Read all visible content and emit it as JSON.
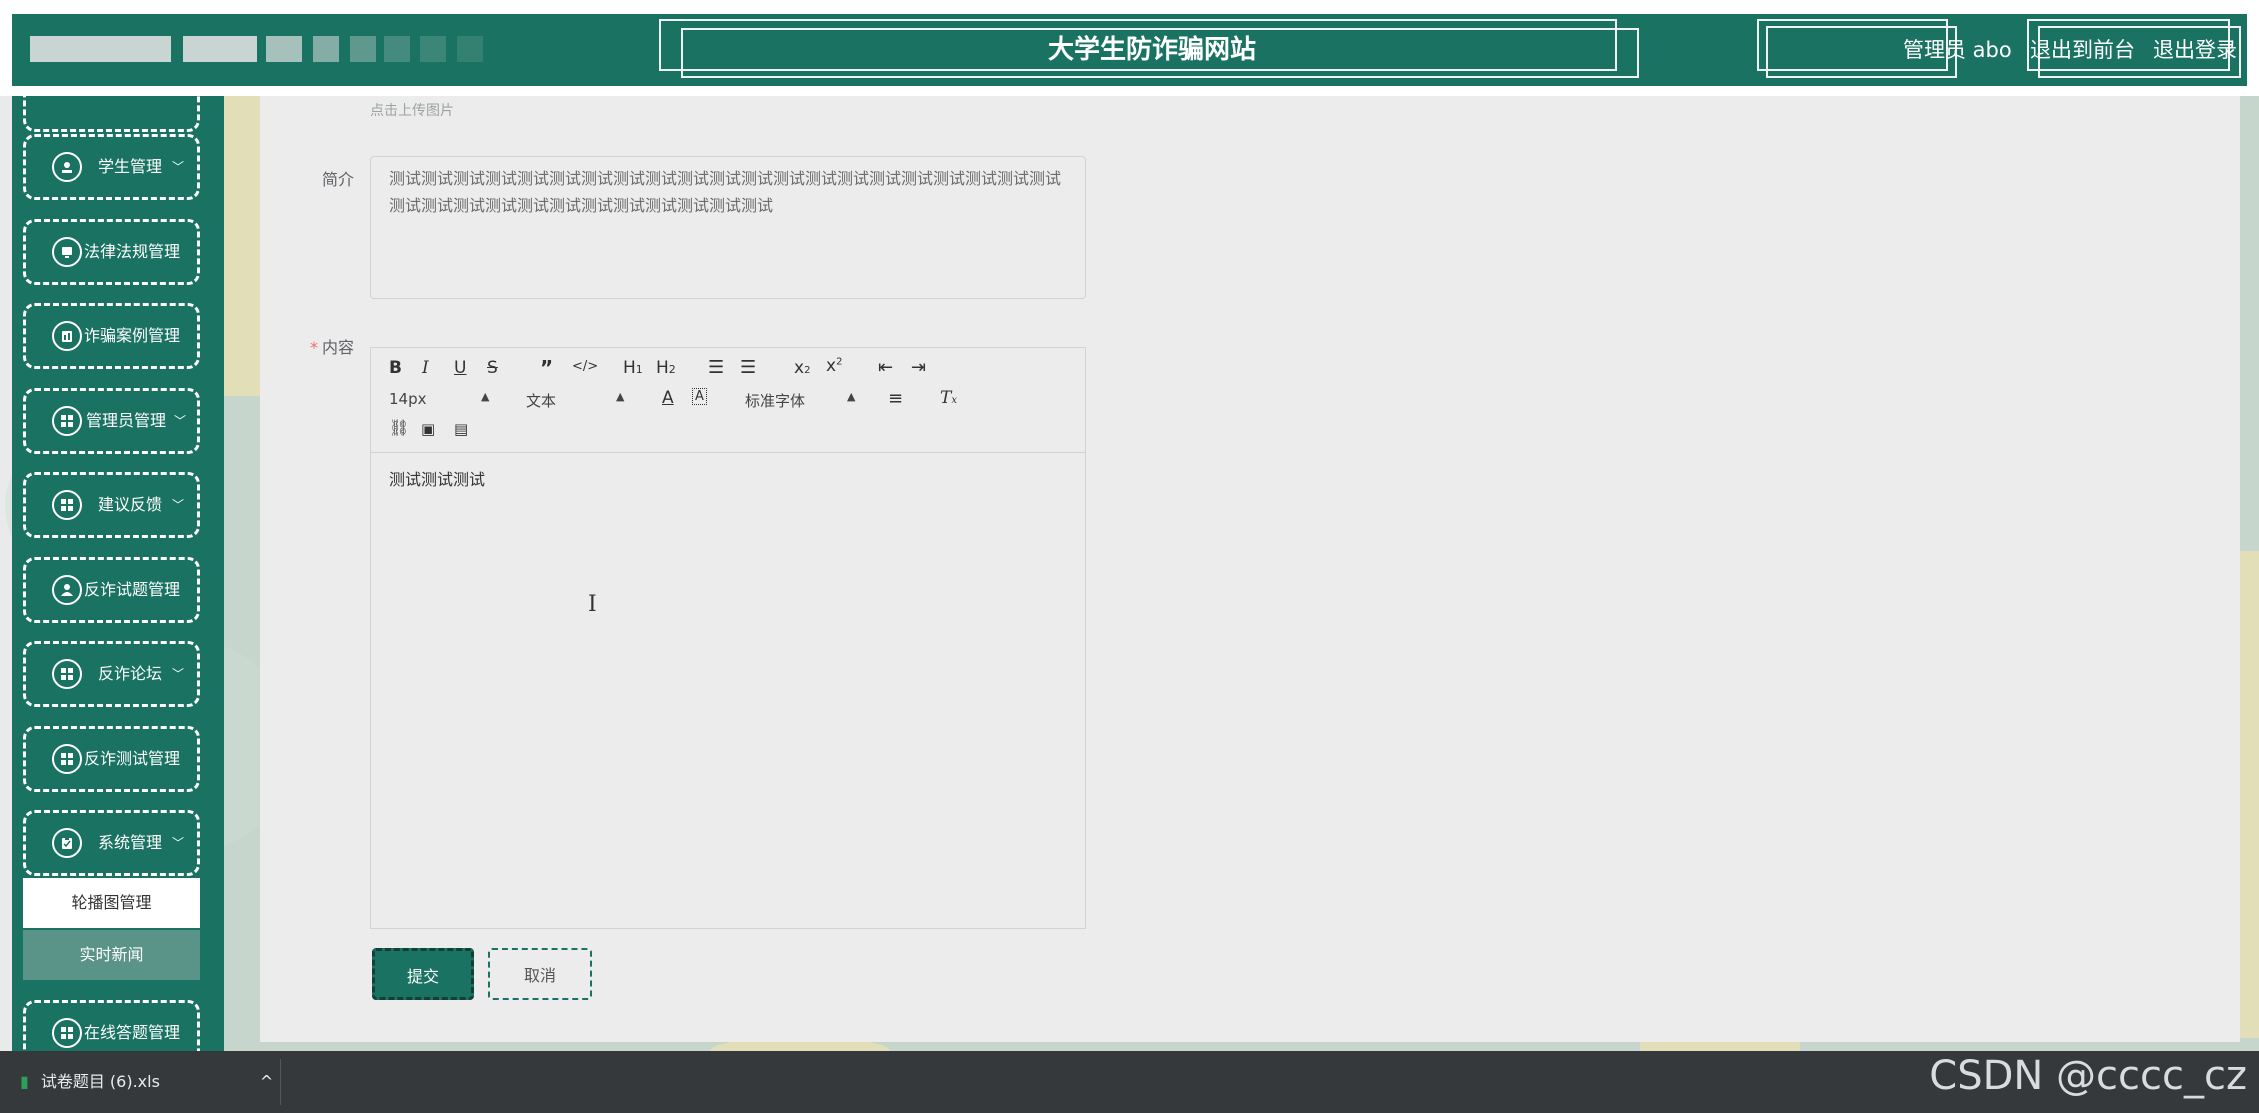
{
  "header": {
    "site_title": "大学生防诈骗网站",
    "admin_label": "管理员 abo",
    "back_to_front": "退出到前台",
    "logout": "退出登录"
  },
  "sidebar": {
    "items": [
      {
        "label": "学生管理",
        "caret": "﹀",
        "icon": "user-circle-icon"
      },
      {
        "label": "法律法规管理",
        "caret": "",
        "icon": "monitor-icon"
      },
      {
        "label": "诈骗案例管理",
        "caret": "",
        "icon": "chart-icon"
      },
      {
        "label": "管理员管理",
        "caret": "﹀",
        "icon": "grid-icon"
      },
      {
        "label": "建议反馈",
        "caret": "﹀",
        "icon": "grid-icon"
      },
      {
        "label": "反诈试题管理",
        "caret": "",
        "icon": "person-icon"
      },
      {
        "label": "反诈论坛",
        "caret": "﹀",
        "icon": "grid-icon"
      },
      {
        "label": "反诈测试管理",
        "caret": "",
        "icon": "grid-icon"
      },
      {
        "label": "系统管理",
        "caret": "﹀",
        "icon": "clipboard-icon"
      }
    ],
    "sub_items": [
      "轮播图管理",
      "实时新闻"
    ],
    "bottom_item": {
      "label": "在线答题管理",
      "icon": "grid-icon"
    }
  },
  "form": {
    "upload_hint": "点击上传图片",
    "intro_label": "简介",
    "intro_value": "测试测试测试测试测试测试测试测试测试测试测试测试测试测试测试测试测试测试测试测试测试测试测试测试测试测试测试测试测试测试测试测试测试",
    "content_required": "*",
    "content_label": "内容",
    "editor": {
      "font_size": "14px",
      "text_style": "文本",
      "font_family": "标准字体",
      "content": "测试测试测试"
    },
    "submit_label": "提交",
    "cancel_label": "取消"
  },
  "downloads": {
    "file_name": "试卷题目 (6).xls",
    "expand": "^"
  },
  "watermark": "CSDN @cccc_cz",
  "colors": {
    "primary": "#1a7262",
    "panel": "#ececec",
    "download_bar": "#36393c"
  }
}
